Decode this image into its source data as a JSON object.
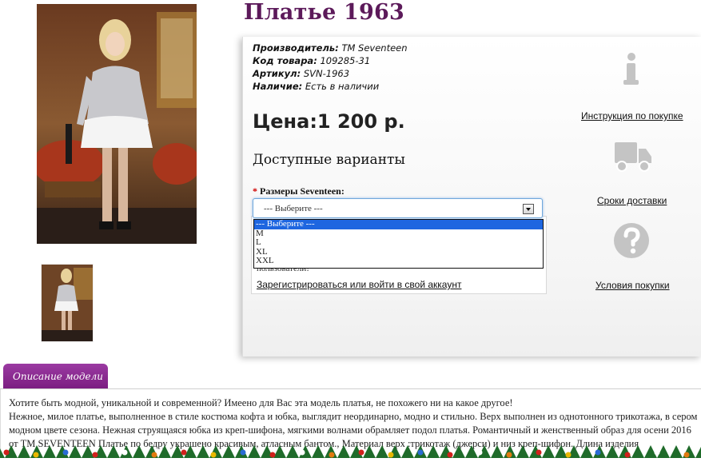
{
  "product": {
    "title": "Платье 1963",
    "meta": [
      {
        "key": "Производитель:",
        "value": "TM Seventeen"
      },
      {
        "key": "Код товара:",
        "value": "109285-31"
      },
      {
        "key": "Артикул:",
        "value": "SVN-1963"
      },
      {
        "key": "Наличие:",
        "value": "Есть в наличии"
      }
    ],
    "price": "Цена:1 200 р.",
    "variants_heading": "Доступные варианты",
    "size_label": "Размеры Seventeen:",
    "size_required_mark": "*",
    "size_select_value": "--- Выберите ---",
    "size_options": [
      "--- Выберите ---",
      "M",
      "L",
      "XL",
      "XXL"
    ],
    "register_note": "пользователи!",
    "register_link": "Зарегистрироваться или войти в свой аккаунт"
  },
  "sidebar": {
    "links": [
      {
        "label": "Инструкция по покупке",
        "icon": "info-icon"
      },
      {
        "label": "Сроки доставки",
        "icon": "truck-icon"
      },
      {
        "label": "Условия покупки",
        "icon": "question-icon"
      }
    ]
  },
  "description": {
    "tab_label": "Описание модели",
    "paragraphs": [
      "Хотите быть модной, уникальной и современной? Имеено для Вас эта модель платья, не похожего ни на какое другое!",
      "Нежное, милое платье, выполненное в стиле костюма кофта и юбка, выглядит неординарно, модно и стильно. Верх выполнен из однотонного трикотажа, в сером модном цвете сезона. Нежная струящаяся юбка из креп-шифона, мягкими волнами обрамляет подол платья. Романтичный и женственный образ для осени 2016 от TM SEVENTEEN Платье по бедру украшено красивым, атласным бантом., Материал верх :трикотаж (джерси) и низ креп-шифон. Длина изделия"
    ]
  },
  "colors": {
    "title": "#5c1a5a",
    "tab": "#8a2a90",
    "select_highlight": "#1e66e0",
    "required_star": "#d00000"
  }
}
